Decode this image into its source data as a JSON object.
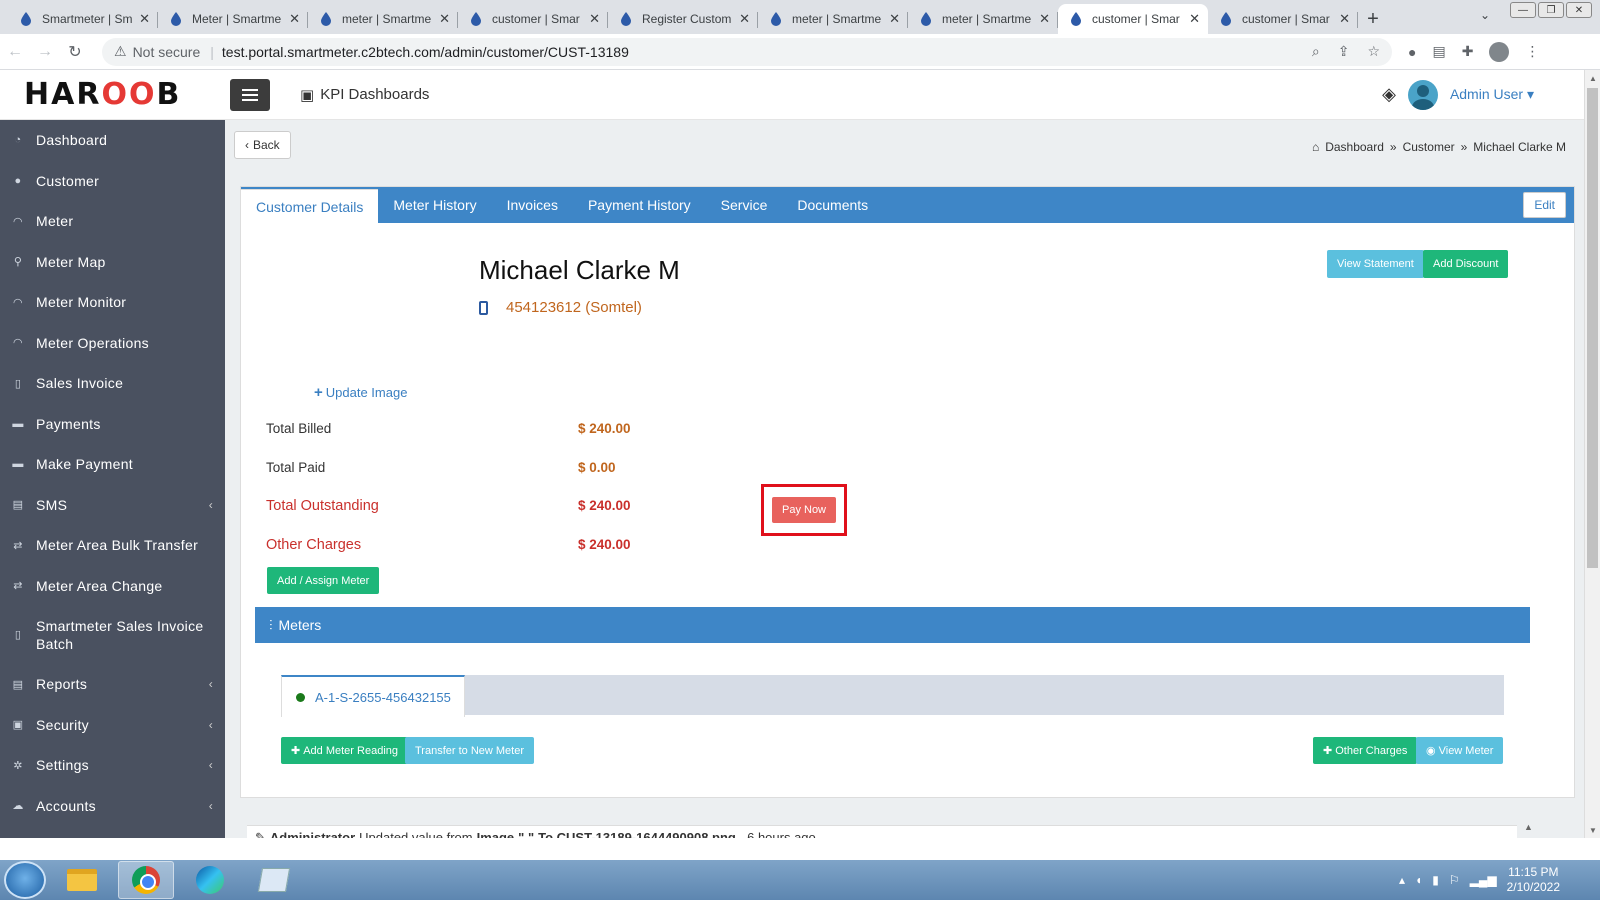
{
  "browser": {
    "tabs": [
      {
        "title": "Smartmeter | Sm"
      },
      {
        "title": "Meter | Smartme"
      },
      {
        "title": "meter | Smartme"
      },
      {
        "title": "customer | Smar"
      },
      {
        "title": "Register Custom"
      },
      {
        "title": "meter | Smartme"
      },
      {
        "title": "meter | Smartme"
      },
      {
        "title": "customer | Smar",
        "active": true
      },
      {
        "title": "customer | Smar"
      }
    ],
    "not_secure": "Not secure",
    "url": "test.portal.smartmeter.c2btech.com/admin/customer/CUST-13189"
  },
  "header": {
    "logo_left": "HAR",
    "logo_mid": "OO",
    "logo_right": "B",
    "kpi_label": "KPI Dashboards",
    "user_label": "Admin User"
  },
  "sidebar": {
    "items": [
      {
        "label": "Dashboard",
        "icon": "pie-chart-icon"
      },
      {
        "label": "Customer",
        "icon": "user-icon"
      },
      {
        "label": "Meter",
        "icon": "gauge-icon"
      },
      {
        "label": "Meter Map",
        "icon": "map-pin-icon"
      },
      {
        "label": "Meter Monitor",
        "icon": "gauge-icon"
      },
      {
        "label": "Meter Operations",
        "icon": "gauge-icon"
      },
      {
        "label": "Sales Invoice",
        "icon": "file-icon"
      },
      {
        "label": "Payments",
        "icon": "card-icon"
      },
      {
        "label": "Make Payment",
        "icon": "card-icon"
      },
      {
        "label": "SMS",
        "icon": "list-icon"
      },
      {
        "label": "Meter Area Bulk Transfer",
        "icon": "transfer-icon"
      },
      {
        "label": "Meter Area Change",
        "icon": "transfer-icon"
      },
      {
        "label": "Smartmeter Sales Invoice Batch",
        "icon": "file-icon"
      },
      {
        "label": "Reports",
        "icon": "list-icon"
      },
      {
        "label": "Security",
        "icon": "lock-icon"
      },
      {
        "label": "Settings",
        "icon": "gear-icon"
      },
      {
        "label": "Accounts",
        "icon": "cloud-icon"
      }
    ]
  },
  "page": {
    "back_label": "Back",
    "breadcrumb": [
      "Dashboard",
      "Customer",
      "Michael Clarke M"
    ],
    "tabs": [
      "Customer Details",
      "Meter History",
      "Invoices",
      "Payment History",
      "Service",
      "Documents"
    ],
    "edit_label": "Edit",
    "customer_name": "Michael Clarke M",
    "phone": "454123612 (Somtel)",
    "view_statement_label": "View Statement",
    "add_discount_label": "Add Discount",
    "update_image_label": "Update Image",
    "summary": {
      "total_billed_label": "Total Billed",
      "total_billed": "$ 240.00",
      "total_paid_label": "Total Paid",
      "total_paid": "$ 0.00",
      "total_outstanding_label": "Total Outstanding",
      "total_outstanding": "$ 240.00",
      "other_charges_label": "Other Charges",
      "other_charges": "$ 240.00"
    },
    "pay_now_label": "Pay Now",
    "assign_meter_label": "Add / Assign Meter",
    "meters_title": "Meters",
    "meter_tab_label": "A-1-S-2655-456432155",
    "add_meter_reading_label": "Add Meter Reading",
    "transfer_label": "Transfer to New Meter",
    "other_charges_btn_label": "Other Charges",
    "view_meter_label": "View Meter",
    "log": {
      "user": "Administrator",
      "text1": "Updated value from",
      "field": "Image",
      "old": "\" \"",
      "to": "To CUST-13189-1644490908.png",
      "time": ", 6 hours ago."
    }
  },
  "taskbar": {
    "time": "11:15 PM",
    "date": "2/10/2022"
  }
}
